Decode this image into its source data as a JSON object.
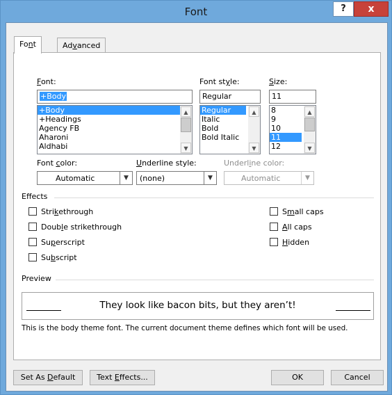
{
  "window": {
    "title": "Font",
    "help_label": "?",
    "close_label": "x"
  },
  "tabs": [
    {
      "pre": "Fo",
      "key": "n",
      "post": "t",
      "active": true
    },
    {
      "pre": "Ad",
      "key": "v",
      "post": "anced",
      "active": false
    }
  ],
  "font": {
    "label_key": "F",
    "label_rest": "ont:",
    "value": "+Body",
    "items": [
      "+Body",
      "+Headings",
      "Agency FB",
      "Aharoni",
      "Aldhabi"
    ],
    "selected": "+Body"
  },
  "font_style": {
    "label_pre": "Font st",
    "label_key": "y",
    "label_post": "le:",
    "value": "Regular",
    "items": [
      "Regular",
      "Italic",
      "Bold",
      "Bold Italic"
    ],
    "selected": "Regular"
  },
  "size": {
    "label_key": "S",
    "label_rest": "ize:",
    "value": "11",
    "items": [
      "8",
      "9",
      "10",
      "11",
      "12"
    ],
    "selected": "11"
  },
  "font_color": {
    "label_pre": "Font ",
    "label_key": "c",
    "label_post": "olor:",
    "value": "Automatic"
  },
  "underline_style": {
    "label_key": "U",
    "label_rest": "nderline style:",
    "value": "(none)"
  },
  "underline_color": {
    "label_pre": "Underl",
    "label_key": "i",
    "label_post": "ne color:",
    "value": "Automatic"
  },
  "effects": {
    "heading": "Effects",
    "left": [
      {
        "pre": "Stri",
        "key": "k",
        "post": "ethrough",
        "checked": false
      },
      {
        "pre": "Doub",
        "key": "l",
        "post": "e strikethrough",
        "checked": false
      },
      {
        "pre": "Su",
        "key": "p",
        "post": "erscript",
        "checked": false
      },
      {
        "pre": "Su",
        "key": "b",
        "post": "script",
        "checked": false
      }
    ],
    "right": [
      {
        "pre": "S",
        "key": "m",
        "post": "all caps",
        "checked": false
      },
      {
        "pre": "",
        "key": "A",
        "post": "ll caps",
        "checked": false
      },
      {
        "pre": "",
        "key": "H",
        "post": "idden",
        "checked": false
      }
    ]
  },
  "preview": {
    "heading": "Preview",
    "sample": "They look like bacon bits, but they aren’t!",
    "description": "This is the body theme font. The current document theme defines which font will be used."
  },
  "buttons": {
    "set_default": {
      "pre": "Set As ",
      "key": "D",
      "post": "efault"
    },
    "text_effects": {
      "pre": "Text ",
      "key": "E",
      "post": "ffects..."
    },
    "ok": "OK",
    "cancel": "Cancel"
  }
}
